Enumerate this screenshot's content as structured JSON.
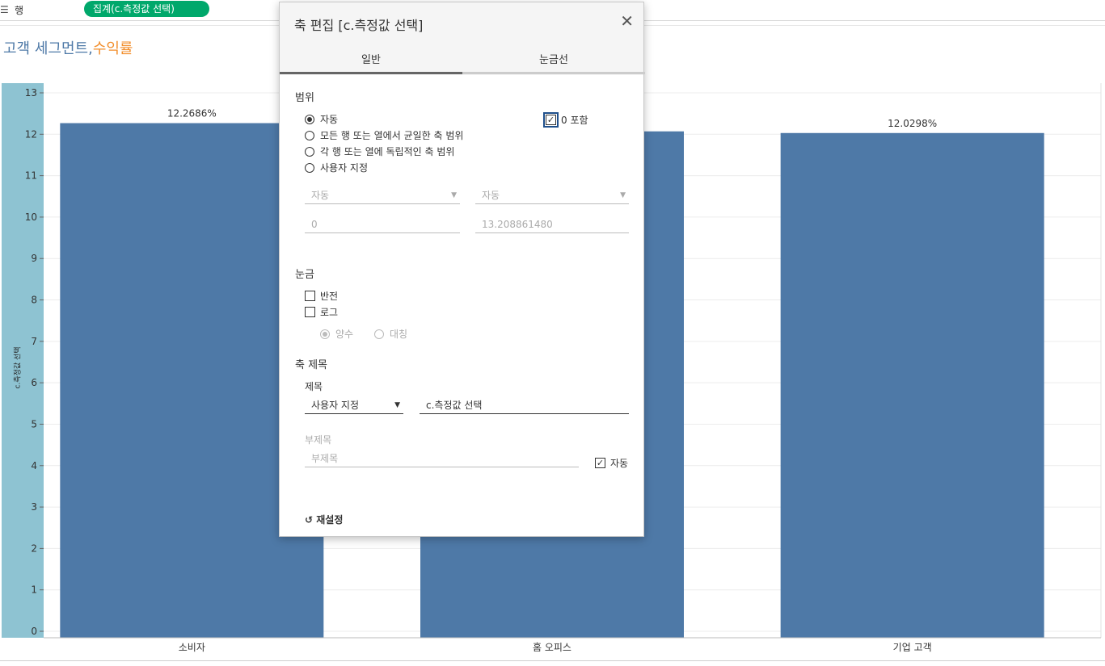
{
  "shelf": {
    "icon": "rows-icon",
    "label": "행",
    "pill": "집계(c.측정값 선택)"
  },
  "sheet_title": {
    "main": "고객 세그먼트,",
    "accent": "수익률"
  },
  "axis_title": "c.측정값 선택",
  "colors": {
    "bar": "#4e79a7",
    "axis_band": "#8ec3d2",
    "pill": "#00a86b",
    "title": "#4e79a7",
    "accent": "#f28e2b"
  },
  "chart_data": {
    "type": "bar",
    "categories": [
      "소비자",
      "홈 오피스",
      "기업 고객"
    ],
    "values": [
      12.2686,
      12.07,
      12.0298
    ],
    "data_labels": [
      "12.2686%",
      "",
      "12.0298%"
    ],
    "ylim": [
      0,
      13
    ],
    "yticks": [
      "0",
      "1",
      "2",
      "3",
      "4",
      "5",
      "6",
      "7",
      "8",
      "9",
      "10",
      "11",
      "12",
      "13"
    ],
    "ylabel": "c.측정값 선택",
    "grid": true
  },
  "dialog": {
    "title": "축 편집 [c.측정값 선택]",
    "close_icon": "close-icon",
    "tabs": [
      "일반",
      "눈금선"
    ],
    "range": {
      "heading": "범위",
      "options": [
        "자동",
        "모든 행 또는 열에서 균일한 축 범위",
        "각 행 또는 열에 독립적인 축 범위",
        "사용자 지정"
      ],
      "selected": 0,
      "include_zero": "0 포함",
      "min_mode": "자동",
      "max_mode": "자동",
      "min_value": "0",
      "max_value": "13.208861480"
    },
    "scale": {
      "heading": "눈금",
      "reversed": "반전",
      "log": "로그",
      "positive": "양수",
      "symmetric": "대칭"
    },
    "axis_title": {
      "heading": "축 제목",
      "title_label": "제목",
      "title_mode": "사용자 지정",
      "title_value": "c.측정값 선택",
      "subtitle_label": "부제목",
      "subtitle_placeholder": "부제목",
      "auto": "자동"
    },
    "reset": "재설정"
  }
}
